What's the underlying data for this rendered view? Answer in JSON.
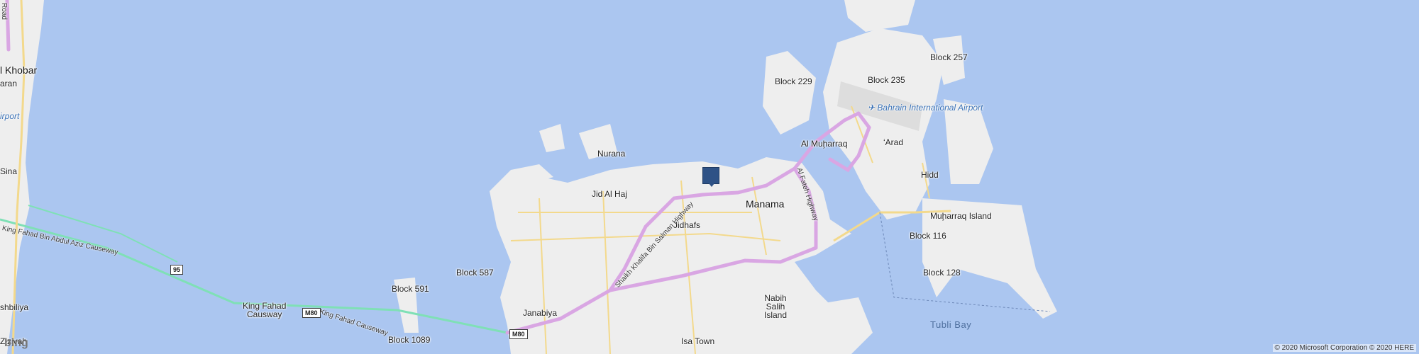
{
  "map": {
    "places": [
      {
        "id": "al-khobar",
        "text": "l Khobar",
        "kind": "city"
      },
      {
        "id": "aran",
        "text": "aran",
        "kind": "place"
      },
      {
        "id": "airport-west",
        "text": "irport",
        "kind": "airport"
      },
      {
        "id": "sina",
        "text": "Sina",
        "kind": "place"
      },
      {
        "id": "shbiliya",
        "text": "shbiliya",
        "kind": "place"
      },
      {
        "id": "zizivah",
        "text": "Zizivah",
        "kind": "place"
      },
      {
        "id": "king-fahad-causway",
        "text": "King Fahad\nCausway",
        "kind": "place"
      },
      {
        "id": "block-591",
        "text": "Block 591",
        "kind": "place"
      },
      {
        "id": "block-587",
        "text": "Block 587",
        "kind": "place"
      },
      {
        "id": "block-1089",
        "text": "Block 1089",
        "kind": "place"
      },
      {
        "id": "janabiya",
        "text": "Janabiya",
        "kind": "place"
      },
      {
        "id": "nurana",
        "text": "Nurana",
        "kind": "place"
      },
      {
        "id": "jid-al-haj",
        "text": "Jid Al Haj",
        "kind": "place"
      },
      {
        "id": "jidhafs",
        "text": "Jidhafs",
        "kind": "place"
      },
      {
        "id": "manama",
        "text": "Manama",
        "kind": "city"
      },
      {
        "id": "isa-town",
        "text": "Isa Town",
        "kind": "place"
      },
      {
        "id": "nabih-salih",
        "text": "Nabih\nSalih\nIsland",
        "kind": "place"
      },
      {
        "id": "block-229",
        "text": "Block 229",
        "kind": "place"
      },
      {
        "id": "block-235",
        "text": "Block 235",
        "kind": "place"
      },
      {
        "id": "block-257",
        "text": "Block 257",
        "kind": "place"
      },
      {
        "id": "al-muharraq",
        "text": "Al Muḩarraq",
        "kind": "place"
      },
      {
        "id": "arad",
        "text": "‘Arad",
        "kind": "place"
      },
      {
        "id": "hidd",
        "text": "Hidd",
        "kind": "place"
      },
      {
        "id": "muharraq-island",
        "text": "Muḩarraq Island",
        "kind": "place"
      },
      {
        "id": "block-116",
        "text": "Block 116",
        "kind": "place"
      },
      {
        "id": "block-128",
        "text": "Block 128",
        "kind": "place"
      },
      {
        "id": "tubli-bay",
        "text": "Tubli Bay",
        "kind": "water"
      },
      {
        "id": "bahrain-airport",
        "text": "Bahrain International Airport",
        "kind": "airport"
      }
    ],
    "roads": [
      {
        "id": "king-fahad-causeway-road",
        "text": "King Fahad Bin Abdul Aziz Causeway"
      },
      {
        "id": "m80-causeway",
        "text": "King Fahad Causeway"
      },
      {
        "id": "sheikh-khalifa-hwy",
        "text": "Shaikh Khalifa Bin Salman Highway"
      },
      {
        "id": "al-fateh-hwy",
        "text": "Al Fateh Highway"
      },
      {
        "id": "road-top-left",
        "text": "Road"
      }
    ],
    "shields": [
      {
        "id": "shield-95",
        "text": "95"
      },
      {
        "id": "shield-m80-a",
        "text": "M80"
      },
      {
        "id": "shield-m80-b",
        "text": "M80"
      }
    ],
    "logo": "bing",
    "attribution": "© 2020 Microsoft Corporation © 2020 HERE",
    "colors": {
      "water": "#abc6f0",
      "land": "#eeeeee",
      "road_major": "#d9a6e3",
      "road_minor": "#f3d98c",
      "causeway": "#7fe0b6",
      "pin": "#2e5286"
    }
  }
}
